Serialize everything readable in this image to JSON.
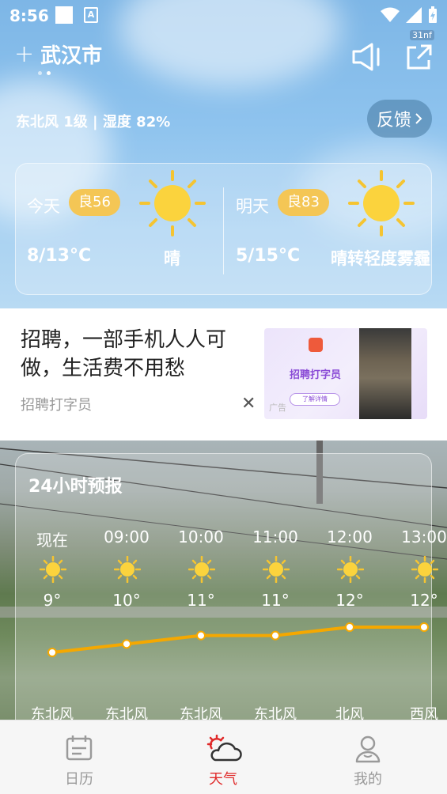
{
  "status_bar": {
    "time": "8:56",
    "a_icon": "A"
  },
  "header": {
    "add_symbol": "+",
    "city": "武汉市",
    "share_badge": "31nf"
  },
  "current": {
    "wind_humidity": "东北风 1级 | 湿度 82%",
    "feedback_label": "反馈"
  },
  "forecast": {
    "today": {
      "label": "今天",
      "aqi": "良56",
      "temp": "8/13°C",
      "condition": "晴",
      "icon": "sun-icon"
    },
    "tomorrow": {
      "label": "明天",
      "aqi": "良83",
      "temp": "5/15°C",
      "condition": "晴转轻度雾霾",
      "icon": "sun-icon"
    }
  },
  "ad": {
    "title": "招聘，一部手机人人可做，生活费不用愁",
    "subtitle": "招聘打字员",
    "close_symbol": "✕",
    "image_title": "招聘打字员",
    "image_button": "了解详情",
    "image_tag": "广告"
  },
  "hourly": {
    "title": "24小时预报",
    "items": [
      {
        "time": "现在",
        "temp": "9°",
        "value": 9,
        "wind": "东北风"
      },
      {
        "time": "09:00",
        "temp": "10°",
        "value": 10,
        "wind": "东北风"
      },
      {
        "time": "10:00",
        "temp": "11°",
        "value": 11,
        "wind": "东北风"
      },
      {
        "time": "11:00",
        "temp": "11°",
        "value": 11,
        "wind": "东北风"
      },
      {
        "time": "12:00",
        "temp": "12°",
        "value": 12,
        "wind": "北风"
      },
      {
        "time": "13:00",
        "temp": "12°",
        "value": 12,
        "wind": "西风"
      }
    ],
    "line_color": "#f5a800"
  },
  "tabbar": {
    "items": [
      {
        "label": "日历",
        "icon": "calendar-icon"
      },
      {
        "label": "天气",
        "icon": "weather-icon",
        "active": true
      },
      {
        "label": "我的",
        "icon": "profile-icon"
      }
    ],
    "active_color": "#e02a2a"
  }
}
